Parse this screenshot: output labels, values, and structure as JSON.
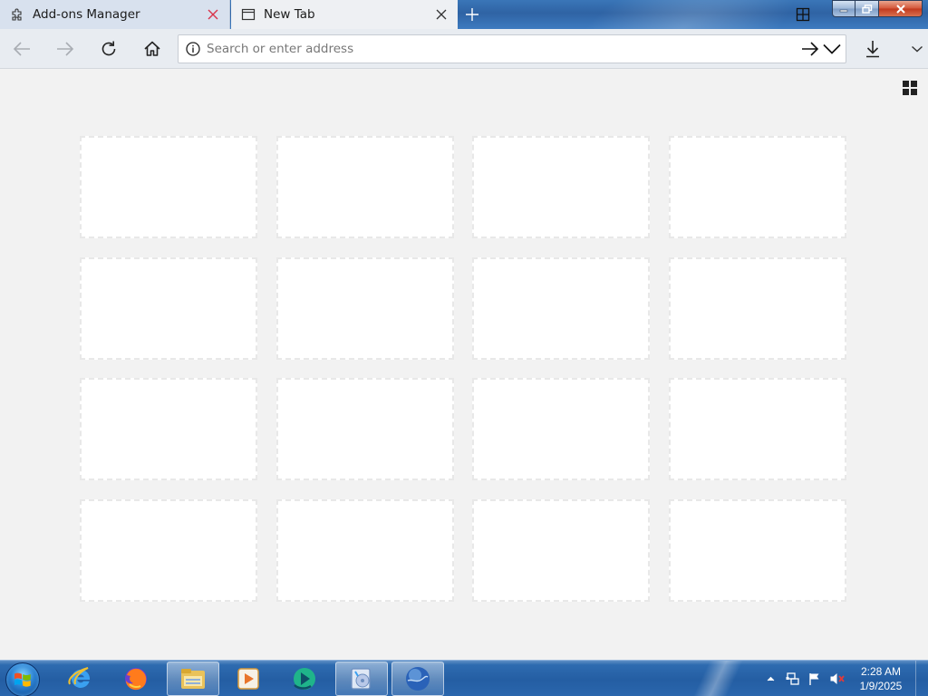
{
  "tabs": [
    {
      "label": "Add-ons Manager",
      "icon": "puzzle-icon",
      "active": false
    },
    {
      "label": "New Tab",
      "icon": "page-icon",
      "active": true
    }
  ],
  "toolbar": {
    "urlbar": {
      "value": "",
      "placeholder": "Search or enter address"
    }
  },
  "content": {
    "tiles": 16
  },
  "taskbar": {
    "apps": [
      {
        "name": "internet-explorer-icon"
      },
      {
        "name": "firefox-icon"
      },
      {
        "name": "file-explorer-icon"
      },
      {
        "name": "media-player-icon"
      },
      {
        "name": "green-app-icon"
      },
      {
        "name": "media-center-icon"
      },
      {
        "name": "browser-globe-icon",
        "active": true
      }
    ],
    "clock": {
      "time": "2:28 AM",
      "date": "1/9/2025"
    }
  },
  "colors": {
    "titlebar": "#2f63a4",
    "toolbar": "#e8ecf1",
    "content_bg": "#f2f2f2",
    "tile_bg": "#ffffff",
    "taskbar": "#245ea3",
    "close_red": "#c23a1e"
  }
}
